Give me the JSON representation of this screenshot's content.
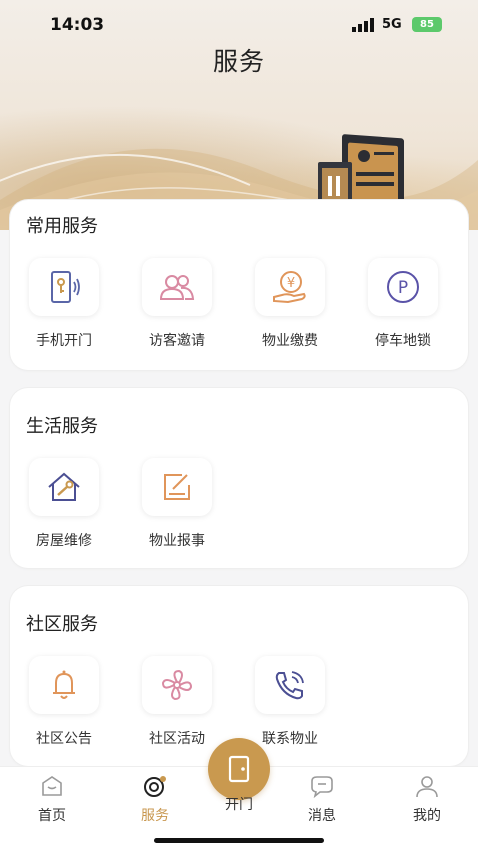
{
  "status_bar": {
    "time": "14:03",
    "network": "5G",
    "battery": "85"
  },
  "header": {
    "title": "服务"
  },
  "sections": [
    {
      "title": "常用服务",
      "items": [
        {
          "label": "手机开门",
          "icon": "phone-door-icon"
        },
        {
          "label": "访客邀请",
          "icon": "visitor-users-icon"
        },
        {
          "label": "物业缴费",
          "icon": "yen-payment-icon"
        },
        {
          "label": "停车地锁",
          "icon": "parking-icon"
        }
      ]
    },
    {
      "title": "生活服务",
      "items": [
        {
          "label": "房屋维修",
          "icon": "house-repair-icon"
        },
        {
          "label": "物业报事",
          "icon": "edit-report-icon"
        }
      ]
    },
    {
      "title": "社区服务",
      "items": [
        {
          "label": "社区公告",
          "icon": "bell-icon"
        },
        {
          "label": "社区活动",
          "icon": "fan-activity-icon"
        },
        {
          "label": "联系物业",
          "icon": "phone-call-icon"
        }
      ]
    }
  ],
  "tabbar": {
    "items": [
      {
        "label": "首页",
        "icon": "home-icon"
      },
      {
        "label": "服务",
        "icon": "service-icon",
        "active": true
      },
      {
        "label": "开门",
        "icon": "door-icon"
      },
      {
        "label": "消息",
        "icon": "message-icon"
      },
      {
        "label": "我的",
        "icon": "profile-icon"
      }
    ]
  },
  "colors": {
    "accent": "#c9994f",
    "battery": "#5cc96b"
  }
}
